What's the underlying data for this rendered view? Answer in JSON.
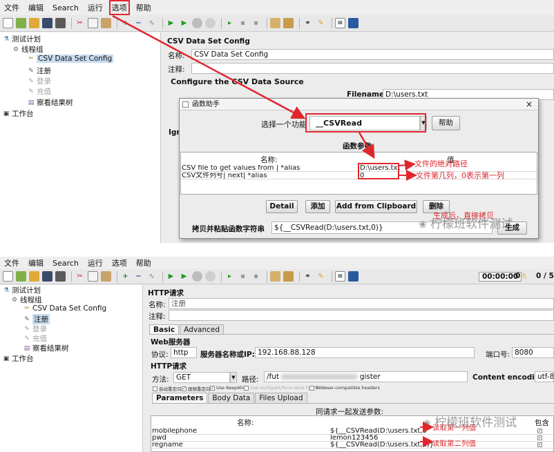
{
  "menu": [
    "文件",
    "编辑",
    "Search",
    "运行",
    "选项",
    "帮助"
  ],
  "shot1": {
    "tree": {
      "test_plan": "测试计划",
      "thread_group": "线程组",
      "csv_config": "CSV Data Set Config",
      "register": "注册",
      "login": "登录",
      "recharge": "充值",
      "results_tree": "察看结果树",
      "workbench": "工作台"
    },
    "panel": {
      "title": "CSV Data Set Config",
      "name_label": "名称:",
      "name_value": "CSV Data Set Config",
      "comment_label": "注释:",
      "section_title": "Configure the CSV Data Source",
      "filename_label": "Filename:",
      "filename_value": "D:\\users.txt",
      "ignore_prefix": "Igr"
    },
    "dialog": {
      "title": "函数助手",
      "close": "×",
      "select_label": "选择一个功能",
      "selected_function": "__CSVRead",
      "help_button": "帮助",
      "params_title": "函数参数",
      "col_name": "名称:",
      "col_value": "值",
      "params": [
        {
          "name": "CSV file to get values from | *alias",
          "value": "D:\\users.txt"
        },
        {
          "name": "CSV文件列号| next| *alias",
          "value": "0"
        }
      ],
      "buttons": {
        "detail": "Detail",
        "add": "添加",
        "add_clipboard": "Add from Clipboard",
        "delete": "删除"
      },
      "copy_label": "拷贝并粘贴函数字符串",
      "function_string": "${__CSVRead(D:\\users.txt,0)}",
      "generate_button": "生成"
    },
    "annotations": {
      "abs_path": "文件的绝对路径",
      "column_hint": "文件第几列，0表示第一列",
      "after_generate": "生成后，直接拷贝"
    },
    "watermark": "柠檬班软件测试"
  },
  "shot2": {
    "timer": "00:00:00",
    "warn_count": "0",
    "threads": "0 / 5",
    "tree": {
      "test_plan": "测试计划",
      "thread_group": "线程组",
      "csv_config": "CSV Data Set Config",
      "register": "注册",
      "login": "登录",
      "recharge": "充值",
      "results_tree": "察看结果树",
      "workbench": "工作台"
    },
    "panel": {
      "title": "HTTP请求",
      "name_label": "名称:",
      "name_value": "注册",
      "comment_label": "注释:",
      "tabs": [
        "Basic",
        "Advanced"
      ],
      "web_server": "Web服务器",
      "protocol_label": "协议:",
      "protocol_value": "http",
      "server_label": "服务器名称或IP:",
      "server_value": "192.168.88.128",
      "port_label": "端口号:",
      "port_value": "8080",
      "http_request": "HTTP请求",
      "method_label": "方法:",
      "method_value": "GET",
      "path_label": "路径:",
      "path_value": "/fut",
      "path_tail": "gister",
      "encoding_label": "Content encoding:",
      "encoding_value": "utf-8",
      "checkboxes": [
        "自动重定向",
        "跟随重定向",
        "Use KeepAlive",
        "Use multipart/form-data for POST",
        "Browser-compatible headers"
      ],
      "param_tabs": [
        "Parameters",
        "Body Data",
        "Files Upload"
      ],
      "send_params_title": "同请求一起发送参数:",
      "col_name": "名称:",
      "col_include": "包含",
      "params": [
        {
          "name": "mobilephone",
          "value": "${__CSVRead(D:\\users.txt,0)}"
        },
        {
          "name": "pwd",
          "value": "lemon123456"
        },
        {
          "name": "regname",
          "value": "${__CSVRead(D:\\users.txt,1)}"
        }
      ]
    },
    "annotations": {
      "read_first": "读取第一列值",
      "read_second": "读取第二列值"
    },
    "watermark": "柠檬班软件测试"
  }
}
